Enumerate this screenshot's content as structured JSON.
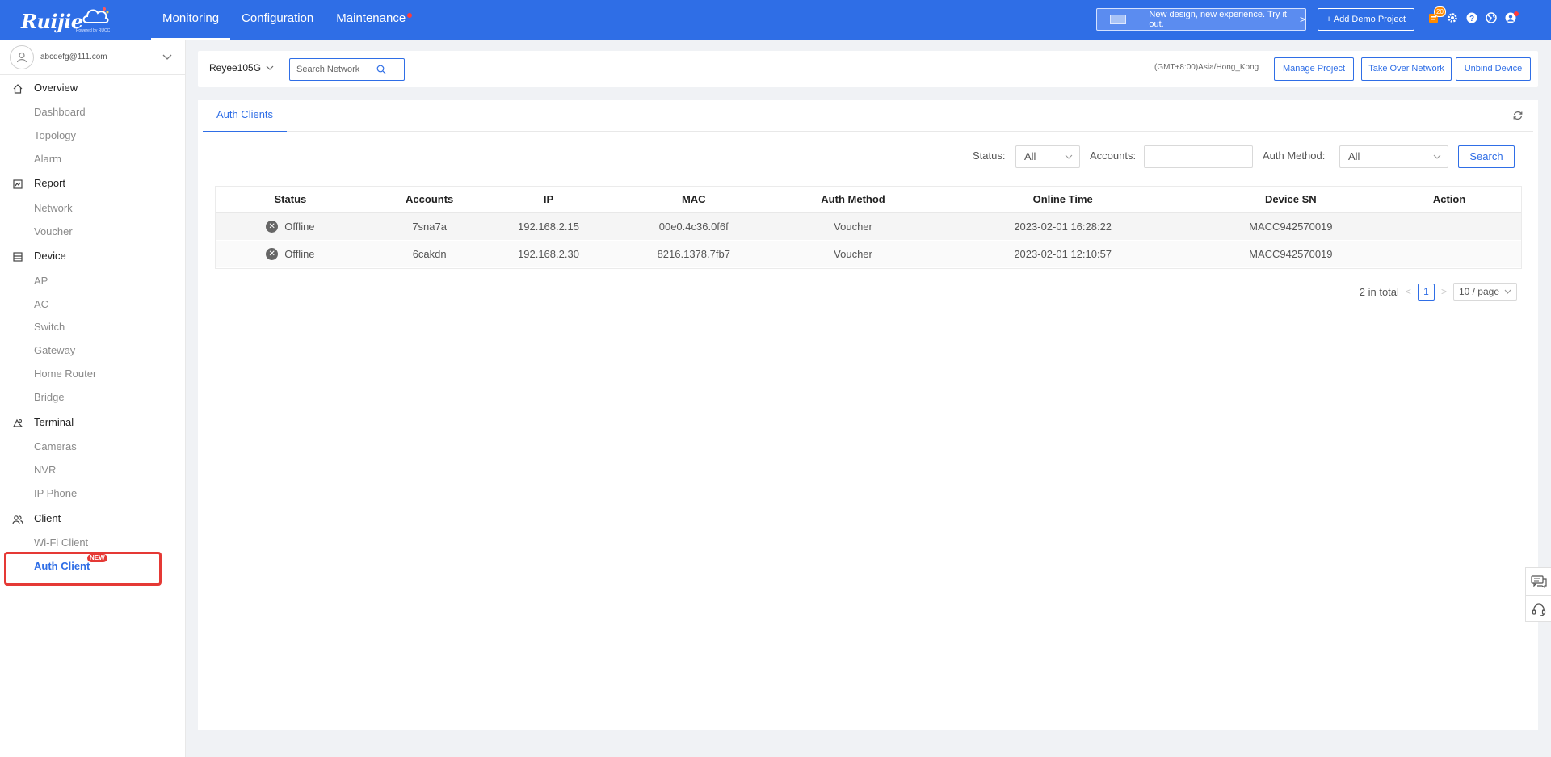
{
  "brand": {
    "name": "Ruijie",
    "sub": "Powered by RUCC"
  },
  "nav": [
    {
      "label": "Monitoring",
      "active": true
    },
    {
      "label": "Configuration",
      "active": false
    },
    {
      "label": "Maintenance",
      "active": false,
      "dot": true
    }
  ],
  "topbar": {
    "new_design": "New design, new experience. Try it out.",
    "add_demo": "+ Add Demo Project",
    "notification_count": "20",
    "icons": [
      "notification-icon",
      "gear-icon",
      "help-icon",
      "globe-icon",
      "user-icon"
    ]
  },
  "user": {
    "email": "abcdefg@111.com"
  },
  "sidebar": {
    "groups": [
      {
        "label": "Overview",
        "icon": "home-icon",
        "items": [
          "Dashboard",
          "Topology",
          "Alarm"
        ]
      },
      {
        "label": "Report",
        "icon": "report-icon",
        "items": [
          "Network",
          "Voucher"
        ]
      },
      {
        "label": "Device",
        "icon": "device-icon",
        "items": [
          "AP",
          "AC",
          "Switch",
          "Gateway",
          "Home Router",
          "Bridge"
        ]
      },
      {
        "label": "Terminal",
        "icon": "terminal-icon",
        "items": [
          "Cameras",
          "NVR",
          "IP Phone"
        ]
      },
      {
        "label": "Client",
        "icon": "client-icon",
        "items": [
          "Wi-Fi Client",
          "Auth Client"
        ]
      }
    ],
    "active_item": "Auth Client",
    "new_badge": "NEW"
  },
  "header": {
    "network": "Reyee105G",
    "search_placeholder": "Search Network",
    "timezone": "(GMT+8:00)Asia/Hong_Kong",
    "manage_project": "Manage Project",
    "take_over": "Take Over Network",
    "unbind": "Unbind Device"
  },
  "main": {
    "tab": "Auth Clients",
    "filters": {
      "status_label": "Status:",
      "status_value": "All",
      "accounts_label": "Accounts:",
      "accounts_value": "",
      "auth_label": "Auth Method:",
      "auth_value": "All",
      "search": "Search"
    },
    "table": {
      "columns": [
        "Status",
        "Accounts",
        "IP",
        "MAC",
        "Auth Method",
        "Online Time",
        "Device SN",
        "Action"
      ],
      "rows": [
        {
          "status": "Offline",
          "account": "7sna7a",
          "ip": "192.168.2.15",
          "mac": "00e0.4c36.0f6f",
          "auth": "Voucher",
          "time": "2023-02-01 16:28:22",
          "sn": "MACC942570019",
          "action": ""
        },
        {
          "status": "Offline",
          "account": "6cakdn",
          "ip": "192.168.2.30",
          "mac": "8216.1378.7fb7",
          "auth": "Voucher",
          "time": "2023-02-01 12:10:57",
          "sn": "MACC942570019",
          "action": ""
        }
      ]
    },
    "pagination": {
      "total": "2 in total",
      "page": "1",
      "page_size": "10 / page"
    }
  }
}
